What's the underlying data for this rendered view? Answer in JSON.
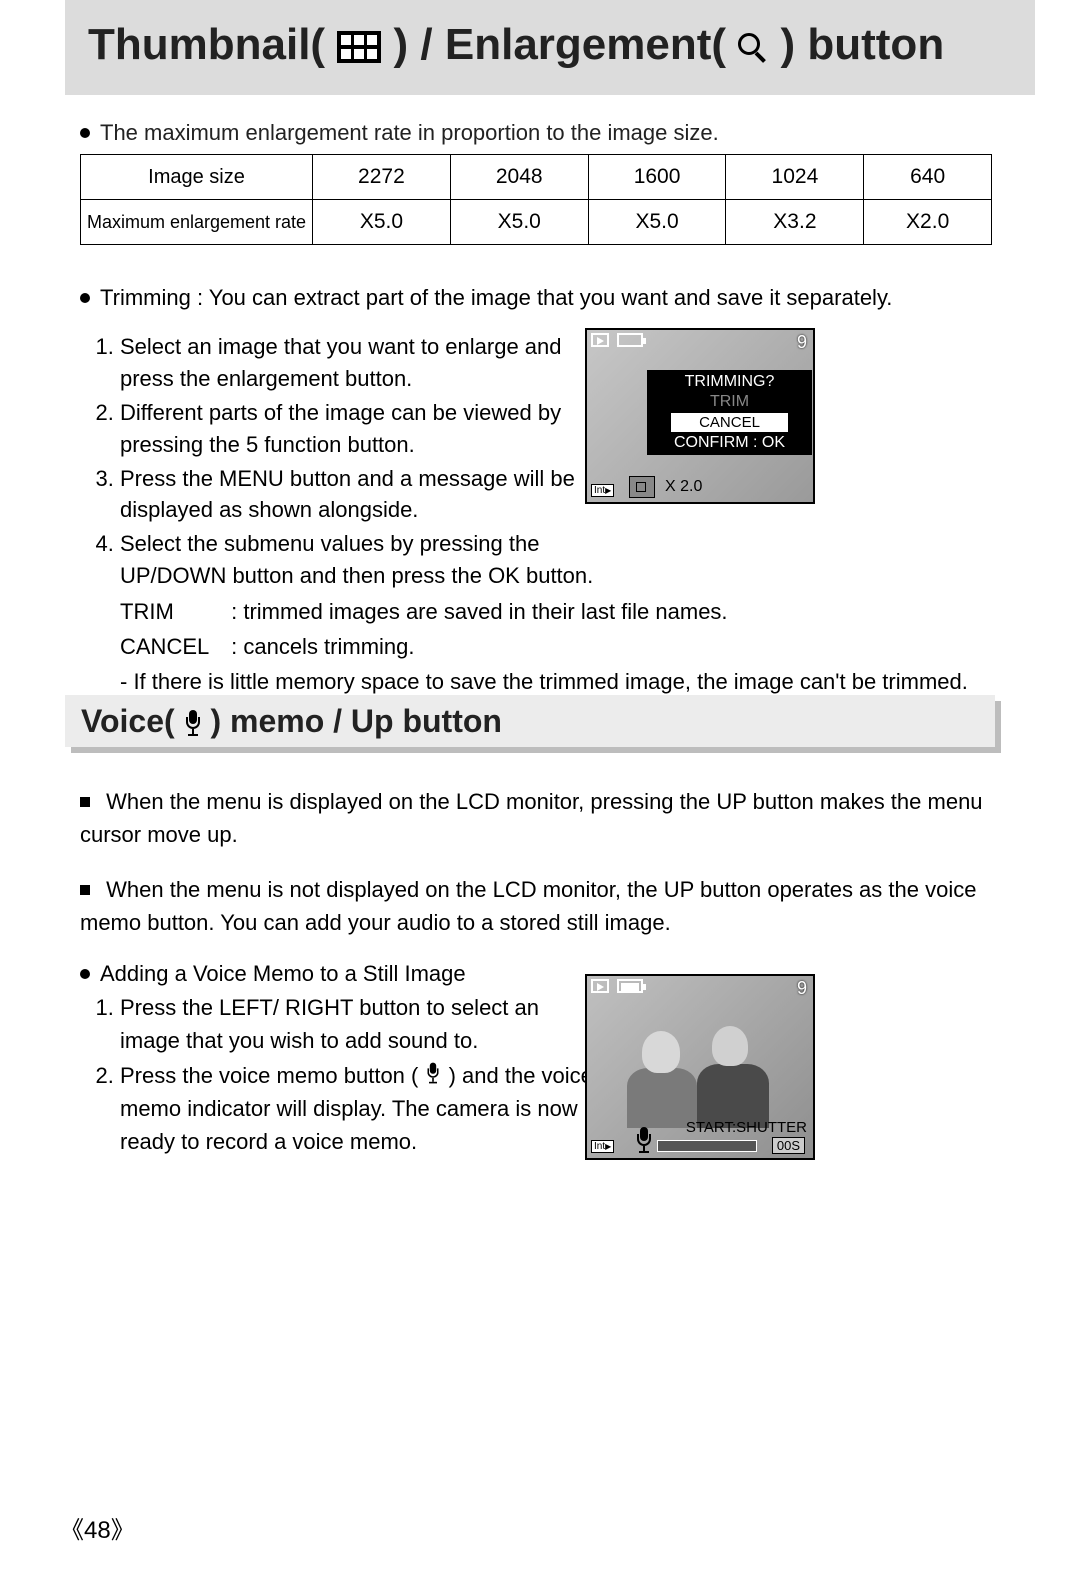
{
  "h1_a": "Thumbnail( ",
  "h1_b": " ) / Enlargement( ",
  "h1_c": " ) button",
  "bullet1": "The maximum enlargement rate in proportion to the image size.",
  "table": {
    "r1": {
      "c0": "Image size",
      "c1": "2272",
      "c2": "2048",
      "c3": "1600",
      "c4": "1024",
      "c5": "640"
    },
    "r2": {
      "c0": "Maximum enlargement rate",
      "c1": "X5.0",
      "c2": "X5.0",
      "c3": "X5.0",
      "c4": "X3.2",
      "c5": "X2.0"
    }
  },
  "trim_intro": "Trimming : You can extract part of the image that you want and save it separately.",
  "trim_steps": {
    "s1": "Select an image that you want to enlarge and press the enlargement button.",
    "s2": "Different parts of the image can be viewed by pressing the 5 function button.",
    "s3": "Press the MENU button and a message will be displayed as shown alongside.",
    "s4": "Select the submenu values by pressing the UP/DOWN button and then press the OK button."
  },
  "def_trim_label": "TRIM",
  "def_trim": ": trimmed images are saved in their last file names.",
  "def_cancel_label": "CANCEL",
  "def_cancel": ": cancels trimming.",
  "note": "- If there is little memory space to save the trimmed image, the image can't be trimmed.",
  "lcd1": {
    "nine": "9",
    "title": "TRIMMING?",
    "trim": "TRIM",
    "cancel": "CANCEL",
    "confirm": "CONFIRM : OK",
    "zoom": "X 2.0",
    "int": "Int",
    "int_arrow": "▶"
  },
  "h2_a": "Voice( ",
  "h2_b": " ) memo / Up button",
  "v_p1": "When the menu is displayed on the LCD monitor, pressing the UP button makes the menu cursor move up.",
  "v_p2": "When the menu is not displayed on the LCD monitor, the UP button operates as the voice memo button. You can add your audio to a stored still image.",
  "add_head": "Adding a Voice Memo to a Still Image",
  "add_steps": {
    "s1": "Press the LEFT/ RIGHT button to select an image that you wish to add sound to.",
    "s2a": "Press the voice memo button ( ",
    "s2b": " ) and the voice memo indicator will display. The camera is now ready to record a voice memo."
  },
  "lcd2": {
    "nine": "9",
    "start": "START:SHUTTER",
    "time": "00S",
    "int": "Int",
    "int_arrow": "▶"
  },
  "page_lb": "《",
  "page_num": "48",
  "page_rb": "》"
}
